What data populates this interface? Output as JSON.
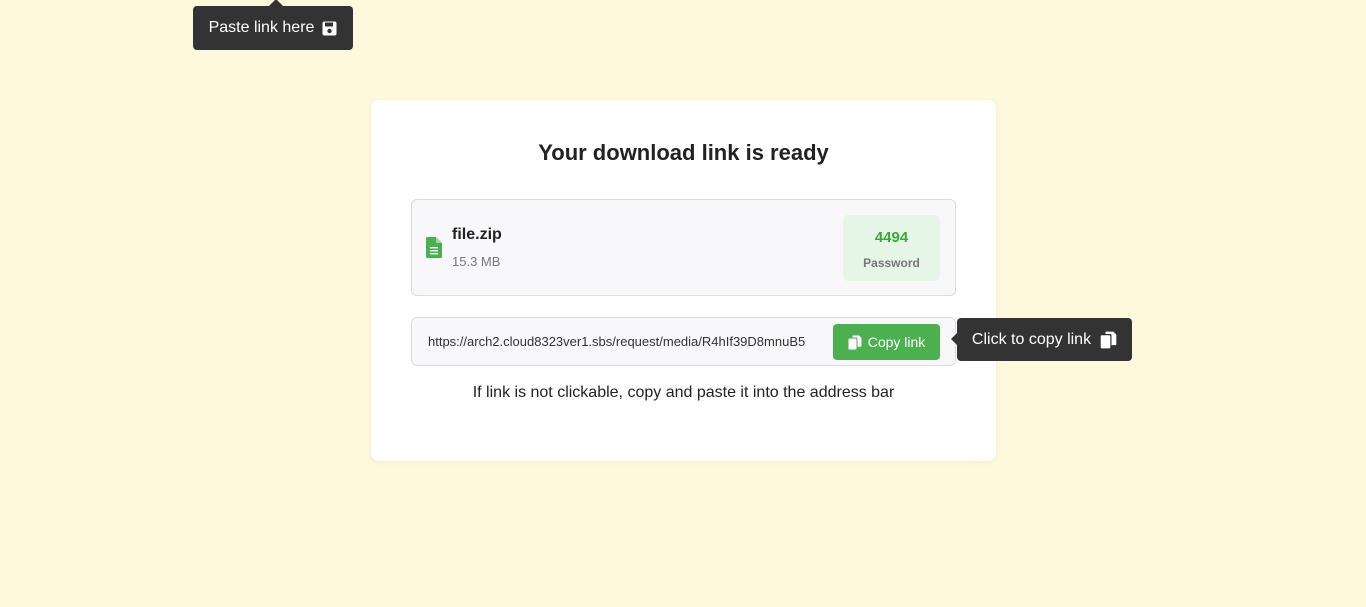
{
  "tooltip_top": {
    "label": "Paste link here",
    "icon": "save-icon"
  },
  "card": {
    "title": "Your download link is ready",
    "file": {
      "icon": "file-icon",
      "name": "file.zip",
      "size": "15.3 MB"
    },
    "password": {
      "value": "4494",
      "label": "Password"
    },
    "link": {
      "url": "https://arch2.cloud8323ver1.sbs/request/media/R4hIf39D8mnuB5",
      "copy_label": "Copy link",
      "copy_icon": "copy-icon"
    },
    "hint": "If link is not clickable, copy and paste it into the address bar"
  },
  "tooltip_right": {
    "label": "Click to copy link",
    "icon": "copy-icon"
  },
  "colors": {
    "background": "#fef8dc",
    "accent": "#4caf50",
    "tooltip": "#333333",
    "password_bg": "#e6f6e6",
    "password_text": "#3ca53c"
  }
}
